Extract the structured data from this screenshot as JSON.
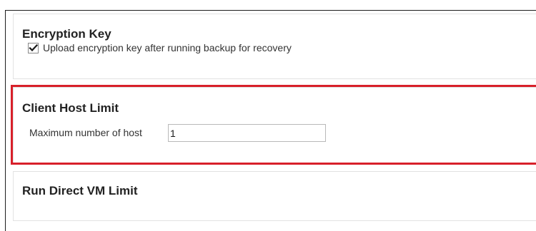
{
  "encryption_panel": {
    "title": "Encryption Key",
    "checkbox_label": "Upload encryption key after running backup for recovery",
    "checked": true
  },
  "client_host_panel": {
    "title": "Client Host Limit",
    "field_label": "Maximum number of host",
    "field_value": "1"
  },
  "vm_panel": {
    "title": "Run Direct VM Limit"
  },
  "colors": {
    "highlight_border": "#d8202a",
    "panel_border": "#e2e2e2"
  },
  "icons": {
    "checkbox": "checkmark-icon"
  }
}
